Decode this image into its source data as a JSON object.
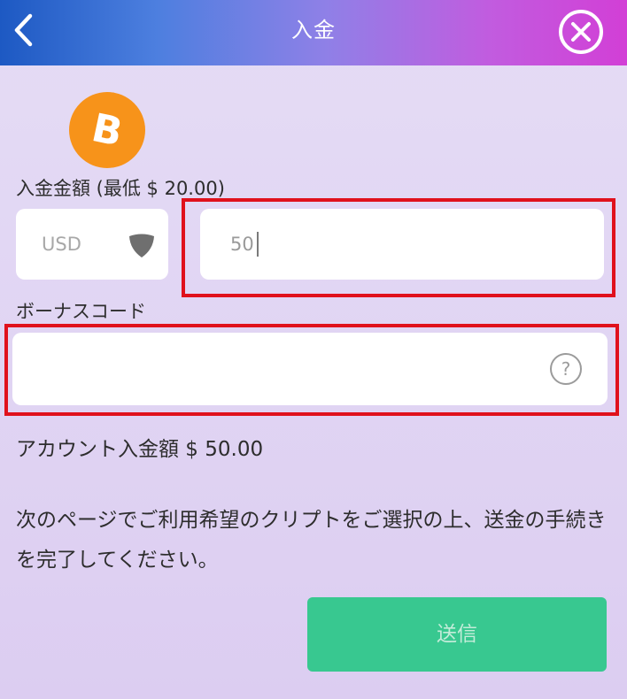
{
  "header": {
    "title": "入金",
    "back_icon": "chevron-left-icon",
    "close_icon": "close-circle-icon"
  },
  "coin": {
    "icon": "bitcoin-icon",
    "symbol": "B",
    "color": "#f7931a"
  },
  "deposit": {
    "amount_label": "入金金額 (最低 $ 20.00)",
    "currency": "USD",
    "currency_dropdown_icon": "shield-dropdown-icon",
    "amount_value": "50"
  },
  "bonus": {
    "label": "ボーナスコード",
    "code_value": "",
    "help_icon": "question-circle-icon"
  },
  "account_amount": "アカウント入金額 $ 50.00",
  "instructions": "次のページでご利用希望のクリプトをご選択の上、送金の手続きを完了してください。",
  "submit_label": "送信",
  "colors": {
    "accent_green": "#38c890",
    "highlight_red": "#e0111c",
    "header_start": "#1d59c3",
    "header_end": "#d23fd6"
  }
}
